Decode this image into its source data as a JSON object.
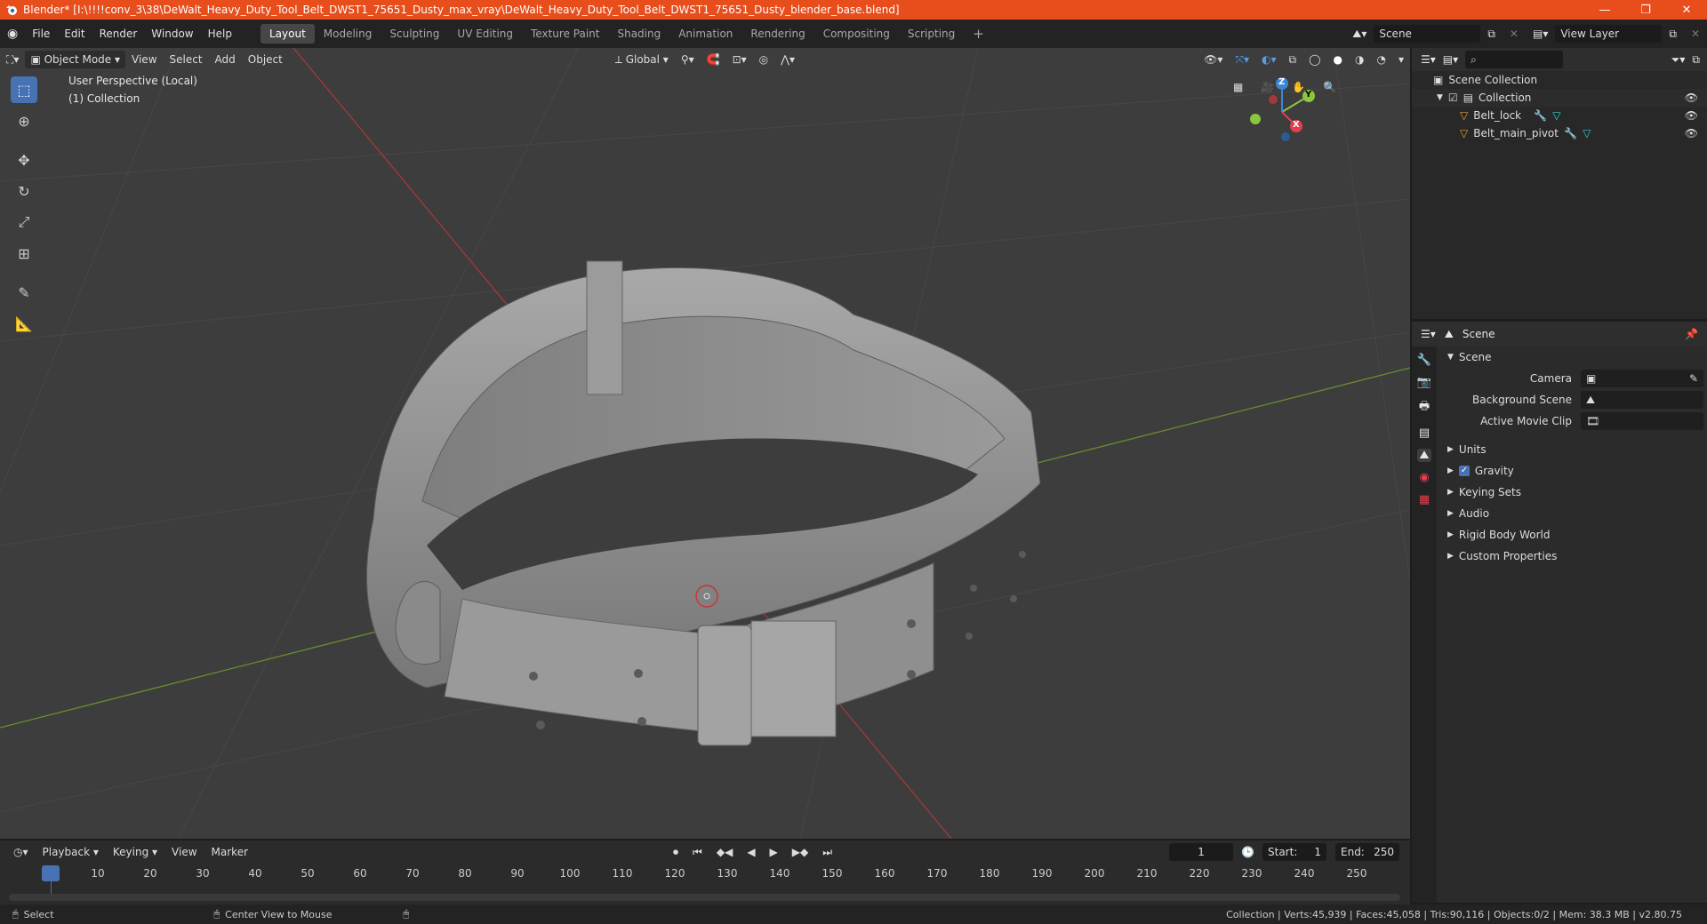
{
  "window": {
    "title": "Blender* [I:\\!!!!conv_3\\38\\DeWalt_Heavy_Duty_Tool_Belt_DWST1_75651_Dusty_max_vray\\DeWalt_Heavy_Duty_Tool_Belt_DWST1_75651_Dusty_blender_base.blend]",
    "minimize": "—",
    "restore": "❐",
    "close": "✕"
  },
  "menu": [
    "File",
    "Edit",
    "Render",
    "Window",
    "Help"
  ],
  "workspaces": [
    "Layout",
    "Modeling",
    "Sculpting",
    "UV Editing",
    "Texture Paint",
    "Shading",
    "Animation",
    "Rendering",
    "Compositing",
    "Scripting"
  ],
  "active_workspace": "Layout",
  "scene_name": "Scene",
  "view_layer": "View Layer",
  "viewport": {
    "mode": "Object Mode",
    "menus": [
      "View",
      "Select",
      "Add",
      "Object"
    ],
    "orientation": "Global",
    "overlay_line1": "User Perspective (Local)",
    "overlay_line2": "(1) Collection",
    "axis_x": "X",
    "axis_y": "Y",
    "axis_z": "Z"
  },
  "outliner": {
    "root": "Scene Collection",
    "collection": "Collection",
    "objects": [
      "Belt_lock",
      "Belt_main_pivot"
    ]
  },
  "properties": {
    "header": "Scene",
    "section": "Scene",
    "camera_label": "Camera",
    "background_scene_label": "Background Scene",
    "active_movie_clip_label": "Active Movie Clip",
    "panels": [
      "Units",
      "Gravity",
      "Keying Sets",
      "Audio",
      "Rigid Body World",
      "Custom Properties"
    ],
    "gravity_enabled": true
  },
  "timeline": {
    "menus": [
      "Playback",
      "Keying",
      "View",
      "Marker"
    ],
    "current_frame": "1",
    "start_label": "Start:",
    "start": "1",
    "end_label": "End:",
    "end": "250",
    "ticks": [
      "1",
      "10",
      "20",
      "30",
      "40",
      "50",
      "60",
      "70",
      "80",
      "90",
      "100",
      "110",
      "120",
      "130",
      "140",
      "150",
      "160",
      "170",
      "180",
      "190",
      "200",
      "210",
      "220",
      "230",
      "240",
      "250"
    ]
  },
  "status": {
    "left_action": "Select",
    "middle_action": "Center View to Mouse",
    "stats": "Collection | Verts:45,939 | Faces:45,058 | Tris:90,116 | Objects:0/2 | Mem: 38.3 MB | v2.80.75"
  },
  "colors": {
    "title_bar": "#e84d1c",
    "accent": "#4772b3",
    "axis_x": "#e04050",
    "axis_y": "#8cc63f",
    "axis_z": "#3a86d6"
  }
}
